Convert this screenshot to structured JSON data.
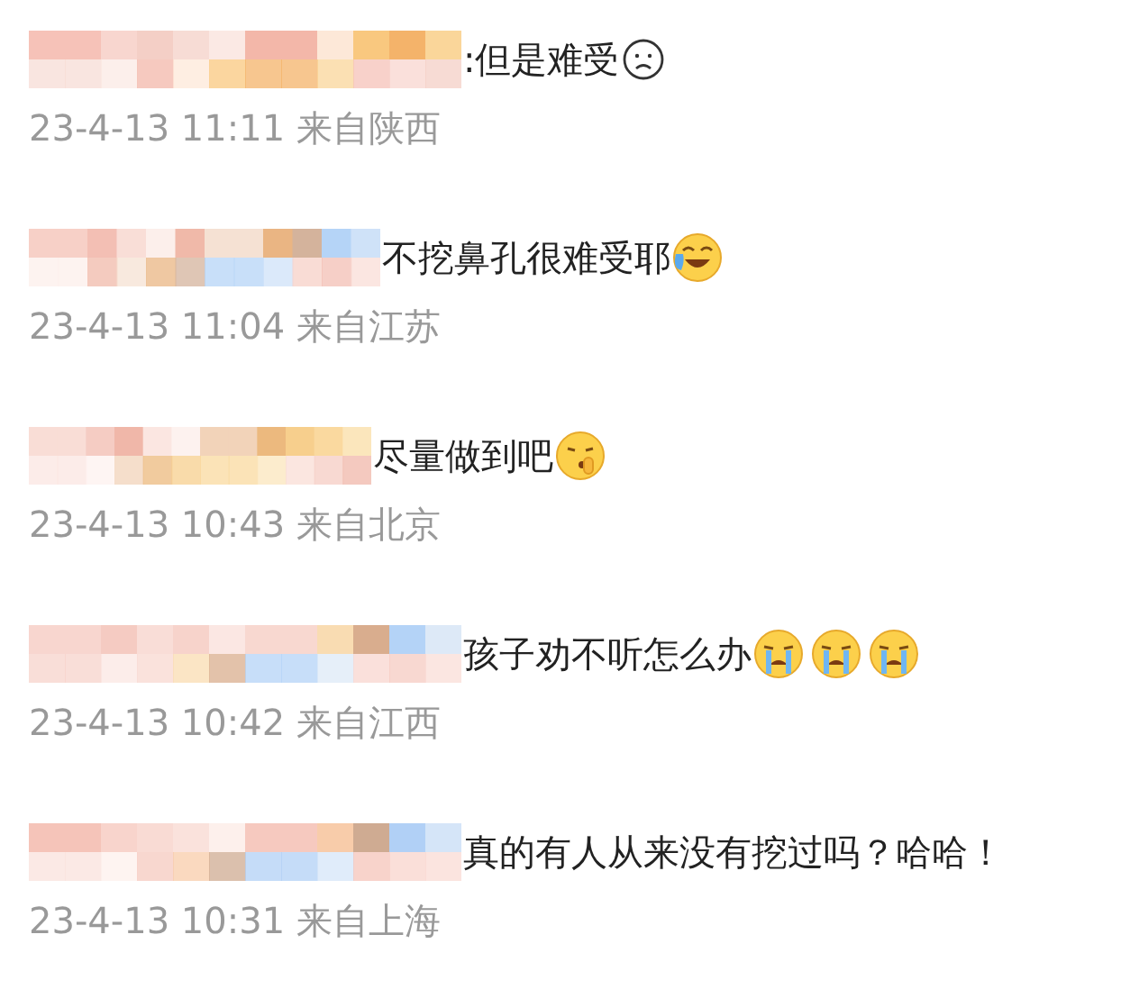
{
  "comments": [
    {
      "text": ":但是难受",
      "emojis": [
        {
          "kind": "frown"
        }
      ],
      "meta": "23-4-13 11:11 来自陕西"
    },
    {
      "text": "不挖鼻孔很难受耶",
      "emojis": [
        {
          "kind": "laugh-cry"
        }
      ],
      "meta": "23-4-13 11:04 来自江苏"
    },
    {
      "text": "尽量做到吧",
      "emojis": [
        {
          "kind": "shush"
        }
      ],
      "meta": "23-4-13 10:43 来自北京"
    },
    {
      "text": "孩子劝不听怎么办",
      "emojis": [
        {
          "kind": "cry"
        },
        {
          "kind": "cry"
        },
        {
          "kind": "cry"
        }
      ],
      "meta": "23-4-13 10:42 来自江西"
    },
    {
      "text": "真的有人从来没有挖过吗？哈哈！",
      "meta": "23-4-13 10:31 来自上海"
    }
  ]
}
